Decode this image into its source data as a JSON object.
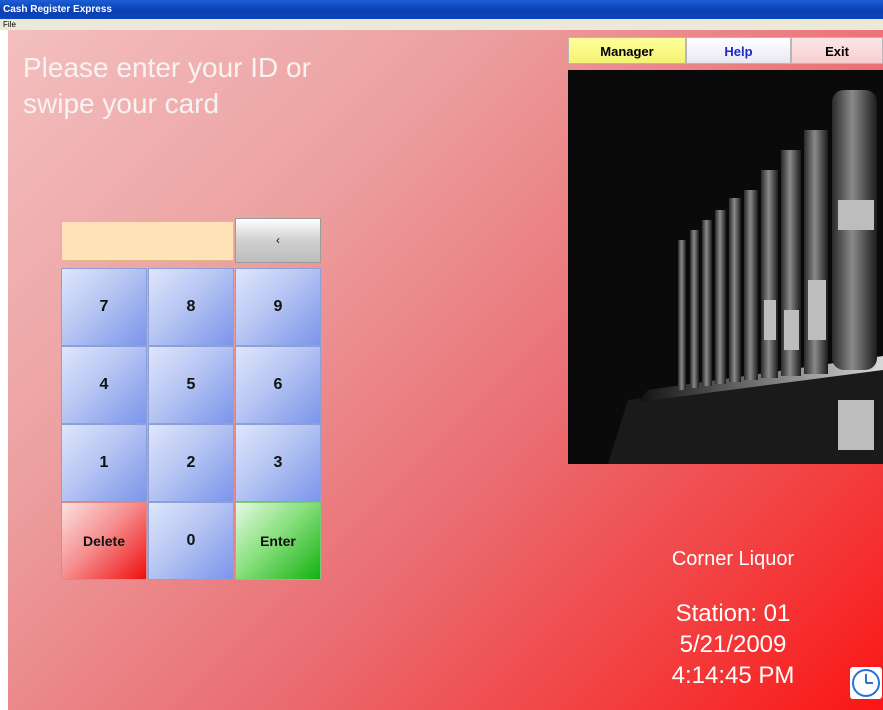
{
  "window": {
    "title": "Cash Register Express"
  },
  "menu": {
    "file": "File"
  },
  "prompt": {
    "line1": "Please enter your ID or",
    "line2": "swipe your card"
  },
  "topbar": {
    "manager": "Manager",
    "help": "Help",
    "exit": "Exit"
  },
  "keypad": {
    "backspace": "‹",
    "keys": [
      "7",
      "8",
      "9",
      "4",
      "5",
      "6",
      "1",
      "2",
      "3",
      "Delete",
      "0",
      "Enter"
    ]
  },
  "info": {
    "store": "Corner Liquor",
    "station": "Station: 01",
    "date": "5/21/2009",
    "time": "4:14:45 PM"
  },
  "icons": {
    "photo": "liquor-bottles-photo",
    "clock": "clock-icon"
  },
  "colors": {
    "manager_bg": "#ffff9a",
    "help_text": "#1a2ad0",
    "display_bg": "#ffe2b6",
    "enter_green": "#14b112",
    "delete_red": "#ee0f0f"
  }
}
